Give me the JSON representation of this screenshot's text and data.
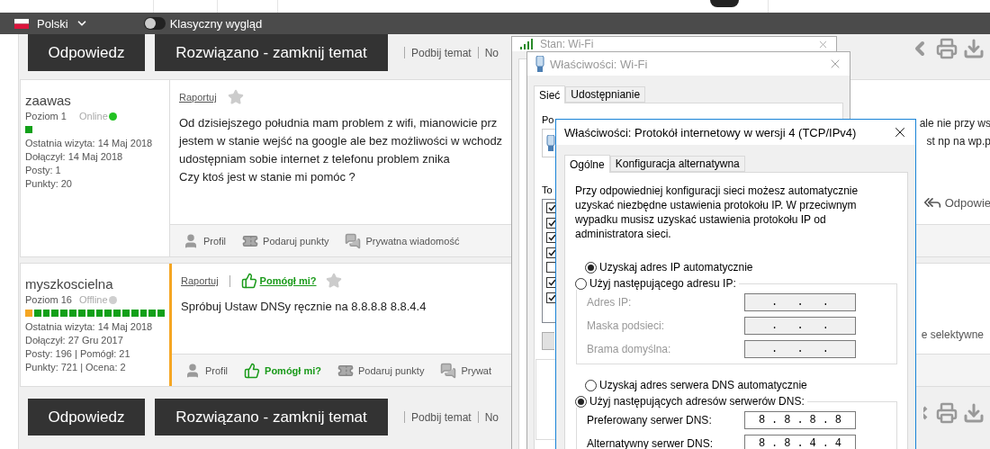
{
  "top_bar": {
    "language": "Polski",
    "classic_view": {
      "label": "Klasyczny wygląd",
      "on": false
    }
  },
  "top_actions": {
    "buttons": [
      "Odpowiedz",
      "Rozwiązano - zamknij temat"
    ],
    "links": [
      "Podbij temat",
      "No"
    ]
  },
  "posts": [
    {
      "author": "zaawas",
      "level": "Poziom 1",
      "status": "Online",
      "online": true,
      "rank": [
        {
          "color": "#12a019"
        }
      ],
      "stats": [
        "Ostatnia wizyta: 14 Maj 2018",
        "Dołączył: 14 Maj 2018",
        "Posty: 1",
        "Punkty: 20"
      ],
      "highlighted": false,
      "report": "Raportuj",
      "lines": [
        {
          "left": "Od dzisiejszego południa mam problem z wifi, mianowicie prz",
          "right": "ale nie przy ws"
        },
        {
          "left": "jestem w stanie wejść na google ale bez możliwości w wchodz",
          "right": "st np na wp.p"
        },
        {
          "left": "udostępniam sobie internet z telefonu problem znika"
        },
        {
          "left": "Czy ktoś jest w stanie mi pomóc ?"
        }
      ],
      "reply": "Odpowie",
      "footer": [
        {
          "kind": "profile",
          "label": "Profil"
        },
        {
          "kind": "gift",
          "label": "Podaruj punkty"
        },
        {
          "kind": "message",
          "label": "Prywatna wiadomość"
        }
      ]
    },
    {
      "author": "myszkoscielna",
      "level": "Poziom 16",
      "status": "Offline",
      "online": false,
      "rank": [
        {
          "color": "#f5a623"
        },
        {
          "color": "#12a019"
        },
        {
          "color": "#12a019"
        },
        {
          "color": "#12a019"
        },
        {
          "color": "#12a019"
        },
        {
          "color": "#12a019"
        },
        {
          "color": "#12a019"
        },
        {
          "color": "#12a019"
        },
        {
          "color": "#12a019"
        },
        {
          "color": "#12a019"
        },
        {
          "color": "#12a019"
        },
        {
          "color": "#12a019"
        },
        {
          "color": "#12a019"
        },
        {
          "color": "#12a019"
        },
        {
          "color": "#12a019"
        },
        {
          "color": "#12a019"
        }
      ],
      "stats": [
        "Ostatnia wizyta: 14 Maj 2018",
        "Dołączył: 27 Gru 2017",
        "Posty: 196 | Pomógł: 21",
        "Punkty: 721 | Ocena: 2"
      ],
      "highlighted": true,
      "report": "Raportuj",
      "helpful": "Pomógł mi?",
      "lines": [
        {
          "left": "Spróbuj Ustaw DNSy ręcznie na 8.8.8.8 8.8.4.4"
        }
      ],
      "side_note": "e selektywne",
      "footer": [
        {
          "kind": "profile",
          "label": "Profil"
        },
        {
          "kind": "helpful",
          "label": "Pomógł mi?"
        },
        {
          "kind": "gift",
          "label": "Podaruj punkty"
        },
        {
          "kind": "message",
          "label": "Prywat"
        }
      ]
    }
  ],
  "bottom_actions": {
    "buttons": [
      "Odpowiedz",
      "Rozwiązano - zamknij temat"
    ],
    "links": [
      "Podbij temat",
      "No"
    ]
  },
  "windows": {
    "status": {
      "title": "Stan: Wi-Fi"
    },
    "wifi_properties": {
      "title": "Właściwości: Wi-Fi",
      "tabs": [
        {
          "label": "Sieć",
          "selected": true
        },
        {
          "label": "Udostępnianie",
          "selected": false
        }
      ],
      "connect_label": "Po",
      "components_label": "To",
      "components": [
        {
          "checked": true
        },
        {
          "checked": true
        },
        {
          "checked": true
        },
        {
          "checked": true
        },
        {
          "checked": false
        },
        {
          "checked": true
        },
        {
          "checked": true
        }
      ]
    },
    "ipv4_properties": {
      "title": "Właściwości: Protokół internetowy w wersji 4 (TCP/IPv4)",
      "tabs": [
        {
          "label": "Ogólne",
          "selected": true
        },
        {
          "label": "Konfiguracja alternatywna",
          "selected": false
        }
      ],
      "description": "Przy odpowiedniej konfiguracji sieci możesz automatycznie uzyskać niezbędne ustawienia protokołu IP. W przeciwnym wypadku musisz uzyskać ustawienia protokołu IP od administratora sieci.",
      "separator": ".",
      "ip_auto": {
        "label": "Uzyskaj adres IP automatycznie",
        "selected": true
      },
      "ip_manual": {
        "label": "Użyj następującego adresu IP:",
        "selected": false
      },
      "ip_fields": [
        {
          "label": "Adres IP:",
          "disabled": true
        },
        {
          "label": "Maska podsieci:",
          "disabled": true
        },
        {
          "label": "Brama domyślna:",
          "disabled": true
        }
      ],
      "dns_auto": {
        "label": "Uzyskaj adres serwera DNS automatycznie",
        "selected": false
      },
      "dns_manual": {
        "label": "Użyj następujących adresów serwerów DNS:",
        "selected": true
      },
      "dns_fields": [
        {
          "label": "Preferowany serwer DNS:",
          "disabled": false,
          "octets": [
            "8",
            "8",
            "8",
            "8"
          ]
        },
        {
          "label": "Alternatywny serwer DNS:",
          "disabled": false,
          "octets": [
            "8",
            "8",
            "4",
            "4"
          ]
        }
      ]
    }
  }
}
